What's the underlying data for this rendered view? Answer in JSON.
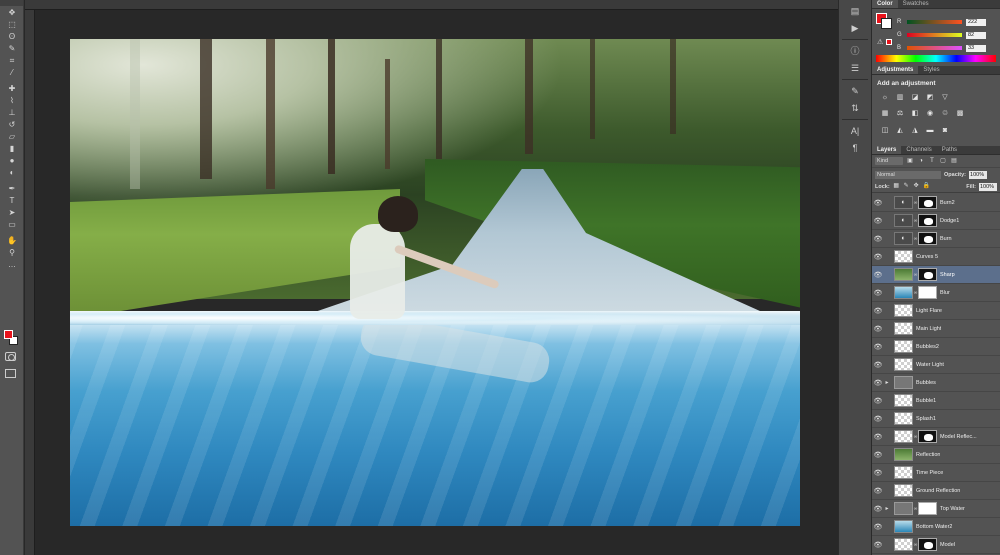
{
  "tools": [
    "move-tool",
    "marquee-tool",
    "lasso-tool",
    "quick-select-tool",
    "crop-tool",
    "eyedropper-tool",
    "healing-brush-tool",
    "brush-tool",
    "clone-stamp-tool",
    "history-brush-tool",
    "eraser-tool",
    "gradient-tool",
    "blur-tool",
    "dodge-tool",
    "pen-tool",
    "type-tool",
    "path-select-tool",
    "shape-tool",
    "hand-tool",
    "zoom-tool"
  ],
  "colors": {
    "foreground": "#e8131b",
    "background": "#ffffff"
  },
  "color_panel": {
    "tabs": [
      "Color",
      "Swatches"
    ],
    "r": {
      "label": "R",
      "value": "222"
    },
    "g": {
      "label": "G",
      "value": "82"
    },
    "b": {
      "label": "B",
      "value": "33"
    }
  },
  "adjustments_panel": {
    "tabs": [
      "Adjustments",
      "Styles"
    ],
    "title": "Add an adjustment"
  },
  "layers_panel": {
    "tabs": [
      "Layers",
      "Channels",
      "Paths"
    ],
    "kind_filter": "Kind",
    "blend_mode": "Normal",
    "opacity_label": "Opacity:",
    "opacity_value": "100%",
    "lock_label": "Lock:",
    "fill_label": "Fill:",
    "fill_value": "100%",
    "layers": [
      {
        "name": "Burn2",
        "type": "adjustment"
      },
      {
        "name": "Dodge1",
        "type": "adjustment"
      },
      {
        "name": "Burn",
        "type": "adjustment"
      },
      {
        "name": "Curves 5",
        "type": "empty"
      },
      {
        "name": "Sharp",
        "type": "image-forest",
        "selected": true
      },
      {
        "name": "Blur",
        "type": "image-water"
      },
      {
        "name": "Light Flare",
        "type": "empty"
      },
      {
        "name": "Main Light",
        "type": "empty"
      },
      {
        "name": "Bubbles2",
        "type": "empty"
      },
      {
        "name": "Water Light",
        "type": "empty"
      },
      {
        "name": "Bubbles",
        "type": "group"
      },
      {
        "name": "Bubble1",
        "type": "empty"
      },
      {
        "name": "Splash1",
        "type": "empty"
      },
      {
        "name": "Model Reflec...",
        "type": "masked"
      },
      {
        "name": "Reflection",
        "type": "image-forest"
      },
      {
        "name": "Time Piece",
        "type": "empty"
      },
      {
        "name": "Ground Reflection",
        "type": "empty"
      },
      {
        "name": "Top Water",
        "type": "group-masked"
      },
      {
        "name": "Bottom Water2",
        "type": "image-water"
      },
      {
        "name": "Model",
        "type": "masked"
      }
    ]
  }
}
